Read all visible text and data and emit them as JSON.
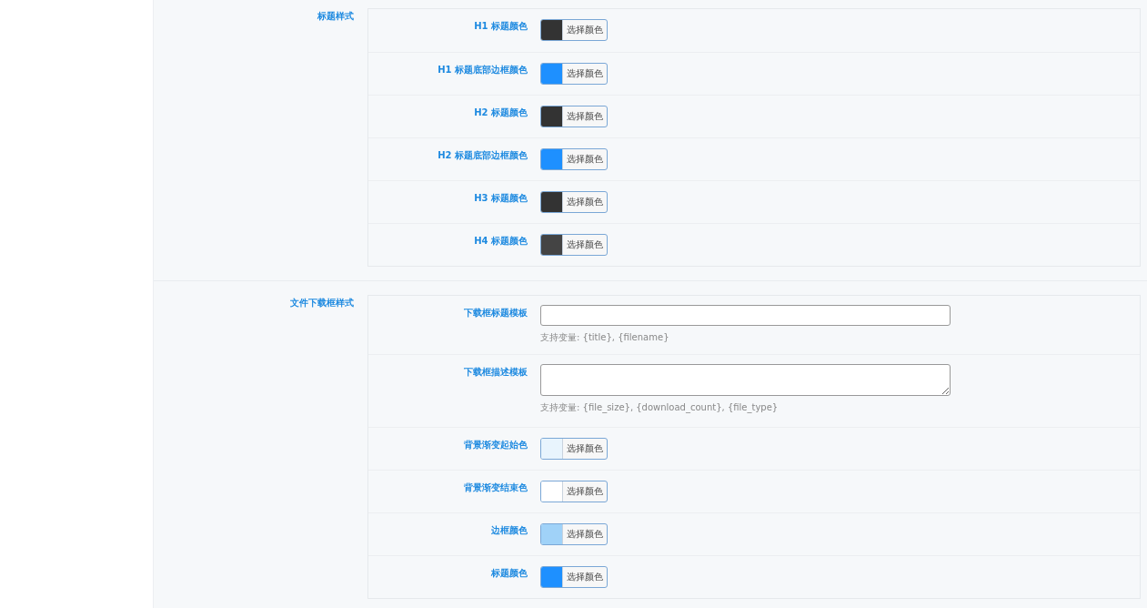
{
  "sections": [
    {
      "title": "标题样式",
      "fields": [
        {
          "kind": "color",
          "label": "H1 标题颜色",
          "color": "#333333",
          "button": "选择颜色"
        },
        {
          "kind": "color",
          "label": "H1 标题底部边框颜色",
          "color": "#1e90ff",
          "button": "选择颜色"
        },
        {
          "kind": "color",
          "label": "H2 标题颜色",
          "color": "#333333",
          "button": "选择颜色"
        },
        {
          "kind": "color",
          "label": "H2 标题底部边框颜色",
          "color": "#1e90ff",
          "button": "选择颜色"
        },
        {
          "kind": "color",
          "label": "H3 标题颜色",
          "color": "#333333",
          "button": "选择颜色"
        },
        {
          "kind": "color",
          "label": "H4 标题颜色",
          "color": "#444444",
          "button": "选择颜色"
        }
      ]
    },
    {
      "title": "文件下载框样式",
      "fields": [
        {
          "kind": "text",
          "label": "下载框标题模板",
          "hint": "支持变量: {title}, {filename}"
        },
        {
          "kind": "textarea",
          "label": "下载框描述模板",
          "hint": "支持变量: {file_size}, {download_count}, {file_type}"
        },
        {
          "kind": "color",
          "label": "背景渐变起始色",
          "color": "#e8f4fd",
          "button": "选择颜色"
        },
        {
          "kind": "color",
          "label": "背景渐变结束色",
          "color": "#ffffff",
          "button": "选择颜色"
        },
        {
          "kind": "color",
          "label": "边框颜色",
          "color": "#a0d2f8",
          "button": "选择颜色"
        },
        {
          "kind": "color",
          "label": "标题颜色",
          "color": "#1e90ff",
          "button": "选择颜色"
        }
      ]
    }
  ]
}
